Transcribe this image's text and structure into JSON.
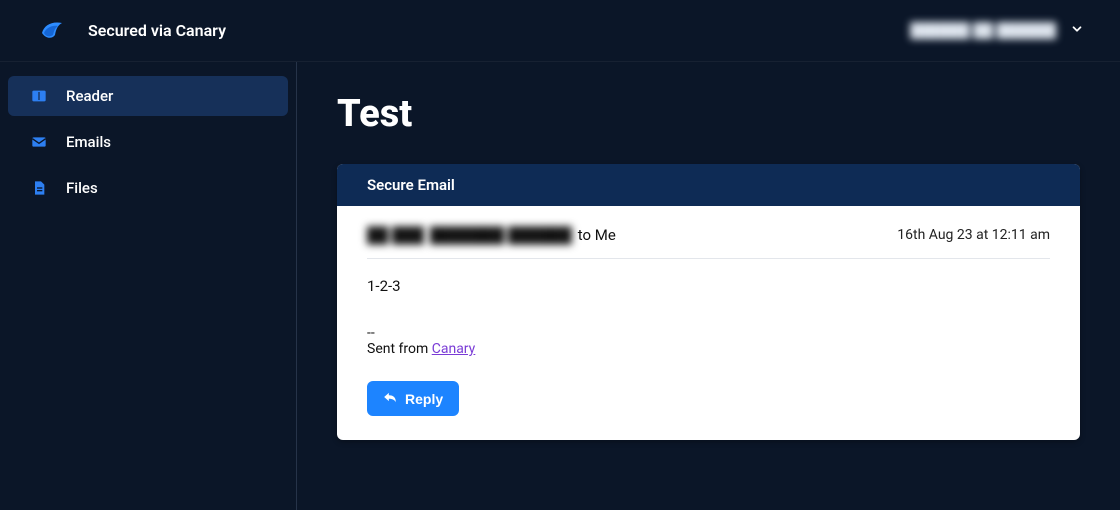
{
  "header": {
    "title": "Secured via Canary",
    "user_display": "██████  ██  ██████"
  },
  "sidebar": {
    "items": [
      {
        "label": "Reader",
        "icon": "reader"
      },
      {
        "label": "Emails",
        "icon": "email"
      },
      {
        "label": "Files",
        "icon": "file"
      }
    ],
    "active_index": 0
  },
  "main": {
    "title": "Test",
    "card_header": "Secure Email",
    "sender_prefix": "██ ███",
    "sender_name": "███████ ██████",
    "sender_to": "to Me",
    "timestamp": "16th Aug 23 at 12:11 am",
    "body": "1-2-3",
    "sig_divider": "--",
    "sig_prefix": "Sent from ",
    "sig_link_text": "Canary",
    "reply_label": "Reply"
  },
  "colors": {
    "accent": "#1d84ff",
    "bg": "#0b1628",
    "card_header_bg": "#0e2b55",
    "sidebar_active": "#163059",
    "link": "#7a3bd6"
  }
}
